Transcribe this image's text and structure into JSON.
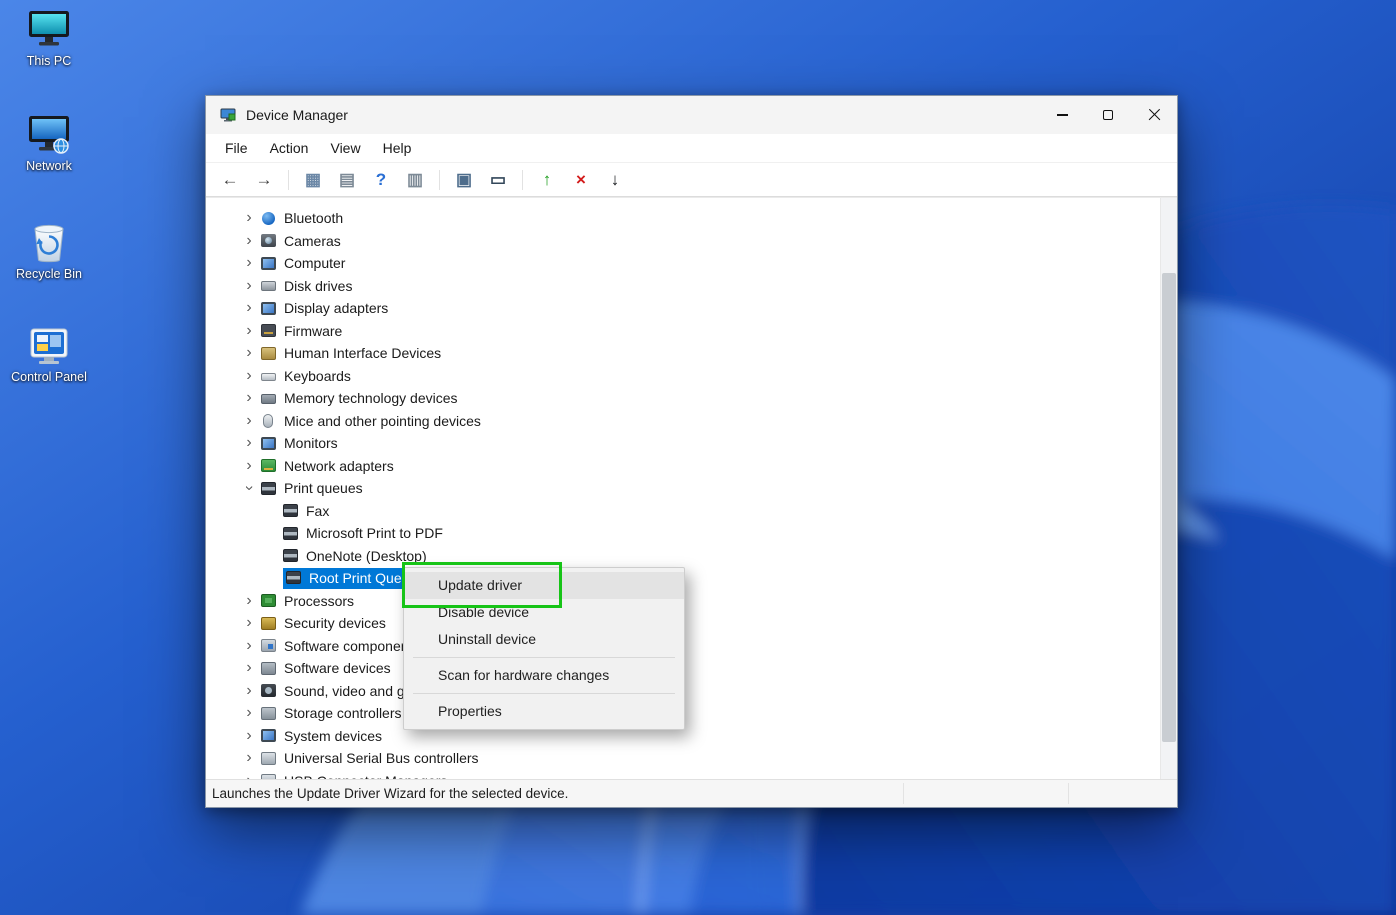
{
  "desktop": {
    "icons": [
      {
        "name": "this-pc",
        "label": "This PC"
      },
      {
        "name": "network",
        "label": "Network"
      },
      {
        "name": "recycle-bin",
        "label": "Recycle Bin"
      },
      {
        "name": "control-panel",
        "label": "Control Panel"
      }
    ]
  },
  "window": {
    "title": "Device Manager",
    "menu_items": [
      "File",
      "Action",
      "View",
      "Help"
    ],
    "status_text": "Launches the Update Driver Wizard for the selected device."
  },
  "toolbar": {
    "buttons": [
      {
        "name": "back",
        "icon": "arrow-left-icon",
        "glyph": "←",
        "color": "#3f3f3f"
      },
      {
        "name": "forward",
        "icon": "arrow-right-icon",
        "glyph": "→",
        "color": "#3f3f3f"
      },
      {
        "type": "separator"
      },
      {
        "name": "show-console-tree",
        "icon": "console-tree-icon",
        "glyph": "▦",
        "color": "#6b87a6"
      },
      {
        "name": "export-list",
        "icon": "list-icon",
        "glyph": "▤",
        "color": "#7d8a96"
      },
      {
        "name": "help",
        "icon": "help-icon",
        "glyph": "?",
        "color": "#2a6fd4"
      },
      {
        "name": "properties",
        "icon": "properties-icon",
        "glyph": "▥",
        "color": "#7d8a96"
      },
      {
        "type": "separator"
      },
      {
        "name": "scan-hardware-changes",
        "icon": "computer-search-icon",
        "glyph": "▣",
        "color": "#4e6d8c"
      },
      {
        "name": "devices-view",
        "icon": "monitor-icon",
        "glyph": "▭",
        "color": "#33475a"
      },
      {
        "type": "separator"
      },
      {
        "name": "update-driver",
        "icon": "update-driver-icon",
        "glyph": "↑",
        "color": "#1d9e1d"
      },
      {
        "name": "uninstall-device",
        "icon": "uninstall-icon",
        "glyph": "×",
        "color": "#d31b1b"
      },
      {
        "name": "disable-device",
        "icon": "disable-icon",
        "glyph": "↓",
        "color": "#16181c"
      }
    ]
  },
  "tree": {
    "items": [
      {
        "label": "Bluetooth",
        "icon": "bluetooth",
        "level": 0,
        "state": "collapsed"
      },
      {
        "label": "Cameras",
        "icon": "camera",
        "level": 0,
        "state": "collapsed"
      },
      {
        "label": "Computer",
        "icon": "computer",
        "level": 0,
        "state": "collapsed"
      },
      {
        "label": "Disk drives",
        "icon": "disk",
        "level": 0,
        "state": "collapsed"
      },
      {
        "label": "Display adapters",
        "icon": "display",
        "level": 0,
        "state": "collapsed"
      },
      {
        "label": "Firmware",
        "icon": "firmware",
        "level": 0,
        "state": "collapsed"
      },
      {
        "label": "Human Interface Devices",
        "icon": "hid",
        "level": 0,
        "state": "collapsed"
      },
      {
        "label": "Keyboards",
        "icon": "keyboard",
        "level": 0,
        "state": "collapsed"
      },
      {
        "label": "Memory technology devices",
        "icon": "memory",
        "level": 0,
        "state": "collapsed"
      },
      {
        "label": "Mice and other pointing devices",
        "icon": "mouse",
        "level": 0,
        "state": "collapsed"
      },
      {
        "label": "Monitors",
        "icon": "monitor",
        "level": 0,
        "state": "collapsed"
      },
      {
        "label": "Network adapters",
        "icon": "network-adapter",
        "level": 0,
        "state": "collapsed"
      },
      {
        "label": "Print queues",
        "icon": "printer",
        "level": 0,
        "state": "expanded"
      },
      {
        "label": "Fax",
        "icon": "printer",
        "level": 1
      },
      {
        "label": "Microsoft Print to PDF",
        "icon": "printer",
        "level": 1
      },
      {
        "label": "OneNote (Desktop)",
        "icon": "printer",
        "level": 1
      },
      {
        "label": "Root Print Queue",
        "icon": "printer",
        "level": 1,
        "selected": true
      },
      {
        "label": "Processors",
        "icon": "processor",
        "level": 0,
        "state": "collapsed"
      },
      {
        "label": "Security devices",
        "icon": "security",
        "level": 0,
        "state": "collapsed"
      },
      {
        "label": "Software components",
        "icon": "software-component",
        "level": 0,
        "state": "collapsed"
      },
      {
        "label": "Software devices",
        "icon": "software-device",
        "level": 0,
        "state": "collapsed"
      },
      {
        "label": "Sound, video and game controllers",
        "icon": "sound",
        "level": 0,
        "state": "collapsed"
      },
      {
        "label": "Storage controllers",
        "icon": "storage",
        "level": 0,
        "state": "collapsed"
      },
      {
        "label": "System devices",
        "icon": "system",
        "level": 0,
        "state": "collapsed"
      },
      {
        "label": "Universal Serial Bus controllers",
        "icon": "usb",
        "level": 0,
        "state": "collapsed"
      },
      {
        "label": "USB Connector Managers",
        "icon": "usb",
        "level": 0,
        "state": "collapsed"
      }
    ]
  },
  "context_menu": {
    "items": [
      {
        "type": "item",
        "label": "Update driver",
        "hovered": true,
        "annotated": true
      },
      {
        "type": "item",
        "label": "Disable device"
      },
      {
        "type": "item",
        "label": "Uninstall device"
      },
      {
        "type": "separator"
      },
      {
        "type": "item",
        "label": "Scan for hardware changes"
      },
      {
        "type": "separator"
      },
      {
        "type": "item",
        "label": "Properties"
      }
    ]
  },
  "colors": {
    "selection": "#0078d7",
    "annotation_green": "#17c417"
  }
}
